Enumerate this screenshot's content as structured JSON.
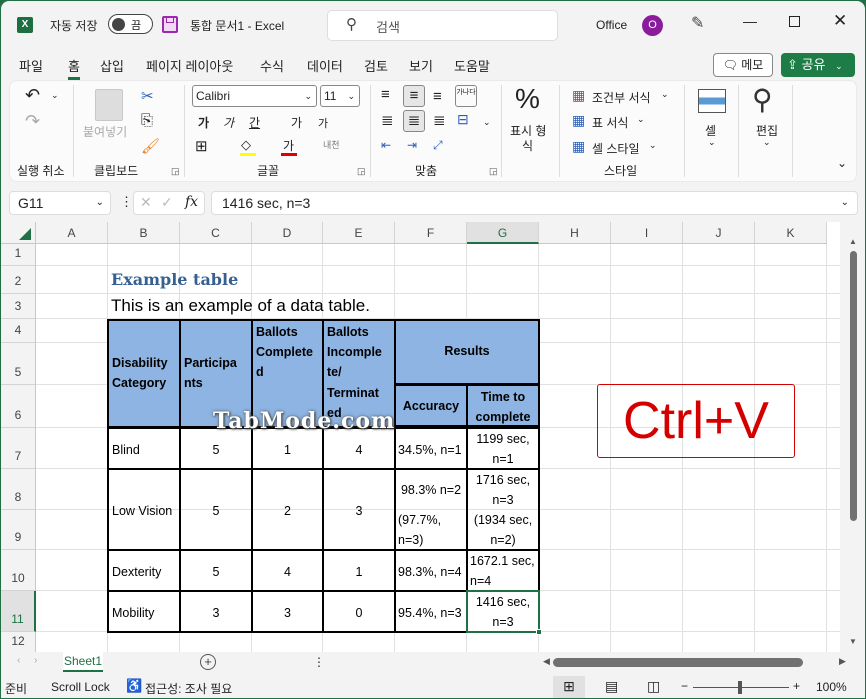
{
  "titlebar": {
    "autosave_label": "자동 저장",
    "autosave_state": "끔",
    "doc_title": "통합 문서1  -  Excel",
    "search_placeholder": "검색",
    "account_name": "Office",
    "avatar_letter": "O",
    "icons": [
      "excel-logo-icon",
      "save-icon",
      "search-icon",
      "pen-icon",
      "minimize-icon",
      "maximize-icon",
      "close-icon"
    ]
  },
  "menu": {
    "tabs": [
      "파일",
      "홈",
      "삽입",
      "페이지 레이아웃",
      "수식",
      "데이터",
      "검토",
      "보기",
      "도움말"
    ],
    "active_tab": "홈",
    "memo_label": "메모",
    "share_label": "공유"
  },
  "ribbon": {
    "undo_group": "실행 취소",
    "clipboard_group": "클립보드",
    "paste_label": "붙여넣기",
    "font_group": "글꼴",
    "font_name": "Calibri",
    "font_size": "11",
    "bold": "가",
    "italic": "가",
    "underline": "간",
    "grow_font": "가",
    "shrink_font": "가",
    "phonetic": "내천",
    "fill_color": "#ffff00",
    "font_color": "#e00000",
    "align_group": "맞춤",
    "wrap_text": "가나다",
    "number_label_1": "표시 형",
    "number_label_2": "식",
    "percent_symbol": "%",
    "styles_group": "스타일",
    "conditional_format": "조건부 서식",
    "table_format": "표 서식",
    "cell_styles": "셀 스타일",
    "cells_label": "셀",
    "editing_label": "편집"
  },
  "formula_bar": {
    "name_box": "G11",
    "fx": "fx",
    "formula": "1416 sec, n=3"
  },
  "columns": [
    "A",
    "B",
    "C",
    "D",
    "E",
    "F",
    "G",
    "H",
    "I",
    "J",
    "K"
  ],
  "selected_column": "G",
  "rows": [
    "1",
    "2",
    "3",
    "4",
    "5",
    "6",
    "7",
    "8",
    "9",
    "10",
    "11",
    "12"
  ],
  "selected_row": "11",
  "sheet": {
    "title": "Example table",
    "subtitle": "This is an example of a data table.",
    "headers": {
      "disability": "Disability Category",
      "participants": "Participa nts",
      "complete": "Ballots Complete d",
      "incomplete_1": "Ballots Incomple te/",
      "incomplete_2": "Terminat ed",
      "results": "Results",
      "accuracy": "Accuracy",
      "time": "Time to complete"
    },
    "rows": [
      {
        "category": "Blind",
        "participants": "5",
        "complete": "1",
        "incomplete": "4",
        "accuracy": "34.5%, n=1",
        "time": "1199 sec, n=1"
      },
      {
        "category": "Low Vision",
        "participants": "5",
        "complete": "2",
        "incomplete": "3",
        "accuracy": "98.3% n=2",
        "accuracy2": "(97.7%, n=3)",
        "time": "1716 sec, n=3",
        "time2": "(1934 sec, n=2)"
      },
      {
        "category": "Dexterity",
        "participants": "5",
        "complete": "4",
        "incomplete": "1",
        "accuracy": "98.3%, n=4",
        "time": "1672.1 sec, n=4"
      },
      {
        "category": "Mobility",
        "participants": "3",
        "complete": "3",
        "incomplete": "0",
        "accuracy": "95.4%, n=3",
        "time": "1416 sec, n=3"
      }
    ],
    "header_fill": "#8db4e2",
    "title_color": "#366092"
  },
  "overlay": {
    "shortcut": "Ctrl+V",
    "watermark": "TabMode.com",
    "color": "#d40000"
  },
  "tabs": {
    "sheet_name": "Sheet1",
    "add_sheet": "+"
  },
  "statusbar": {
    "ready": "준비",
    "scroll_lock": "Scroll Lock",
    "accessibility": "접근성: 조사 필요",
    "zoom_minus": "−",
    "zoom_plus": "+",
    "zoom_level": "100%"
  }
}
